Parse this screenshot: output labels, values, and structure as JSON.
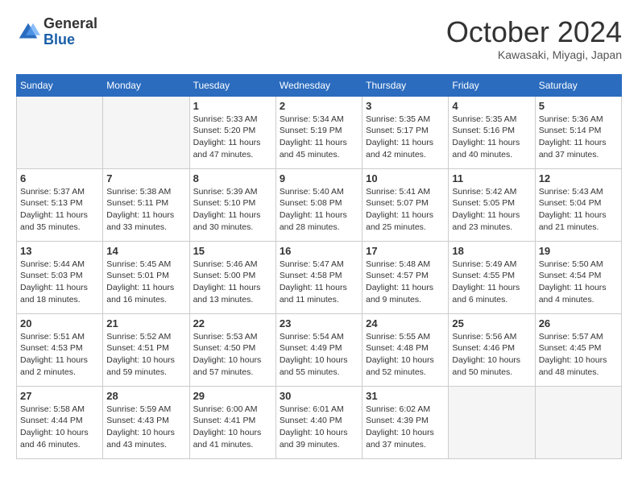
{
  "header": {
    "logo_line1": "General",
    "logo_line2": "Blue",
    "month_title": "October 2024",
    "location": "Kawasaki, Miyagi, Japan"
  },
  "days_of_week": [
    "Sunday",
    "Monday",
    "Tuesday",
    "Wednesday",
    "Thursday",
    "Friday",
    "Saturday"
  ],
  "weeks": [
    [
      {
        "num": "",
        "empty": true
      },
      {
        "num": "",
        "empty": true
      },
      {
        "num": "1",
        "sunrise": "5:33 AM",
        "sunset": "5:20 PM",
        "daylight": "11 hours and 47 minutes."
      },
      {
        "num": "2",
        "sunrise": "5:34 AM",
        "sunset": "5:19 PM",
        "daylight": "11 hours and 45 minutes."
      },
      {
        "num": "3",
        "sunrise": "5:35 AM",
        "sunset": "5:17 PM",
        "daylight": "11 hours and 42 minutes."
      },
      {
        "num": "4",
        "sunrise": "5:35 AM",
        "sunset": "5:16 PM",
        "daylight": "11 hours and 40 minutes."
      },
      {
        "num": "5",
        "sunrise": "5:36 AM",
        "sunset": "5:14 PM",
        "daylight": "11 hours and 37 minutes."
      }
    ],
    [
      {
        "num": "6",
        "sunrise": "5:37 AM",
        "sunset": "5:13 PM",
        "daylight": "11 hours and 35 minutes."
      },
      {
        "num": "7",
        "sunrise": "5:38 AM",
        "sunset": "5:11 PM",
        "daylight": "11 hours and 33 minutes."
      },
      {
        "num": "8",
        "sunrise": "5:39 AM",
        "sunset": "5:10 PM",
        "daylight": "11 hours and 30 minutes."
      },
      {
        "num": "9",
        "sunrise": "5:40 AM",
        "sunset": "5:08 PM",
        "daylight": "11 hours and 28 minutes."
      },
      {
        "num": "10",
        "sunrise": "5:41 AM",
        "sunset": "5:07 PM",
        "daylight": "11 hours and 25 minutes."
      },
      {
        "num": "11",
        "sunrise": "5:42 AM",
        "sunset": "5:05 PM",
        "daylight": "11 hours and 23 minutes."
      },
      {
        "num": "12",
        "sunrise": "5:43 AM",
        "sunset": "5:04 PM",
        "daylight": "11 hours and 21 minutes."
      }
    ],
    [
      {
        "num": "13",
        "sunrise": "5:44 AM",
        "sunset": "5:03 PM",
        "daylight": "11 hours and 18 minutes."
      },
      {
        "num": "14",
        "sunrise": "5:45 AM",
        "sunset": "5:01 PM",
        "daylight": "11 hours and 16 minutes."
      },
      {
        "num": "15",
        "sunrise": "5:46 AM",
        "sunset": "5:00 PM",
        "daylight": "11 hours and 13 minutes."
      },
      {
        "num": "16",
        "sunrise": "5:47 AM",
        "sunset": "4:58 PM",
        "daylight": "11 hours and 11 minutes."
      },
      {
        "num": "17",
        "sunrise": "5:48 AM",
        "sunset": "4:57 PM",
        "daylight": "11 hours and 9 minutes."
      },
      {
        "num": "18",
        "sunrise": "5:49 AM",
        "sunset": "4:55 PM",
        "daylight": "11 hours and 6 minutes."
      },
      {
        "num": "19",
        "sunrise": "5:50 AM",
        "sunset": "4:54 PM",
        "daylight": "11 hours and 4 minutes."
      }
    ],
    [
      {
        "num": "20",
        "sunrise": "5:51 AM",
        "sunset": "4:53 PM",
        "daylight": "11 hours and 2 minutes."
      },
      {
        "num": "21",
        "sunrise": "5:52 AM",
        "sunset": "4:51 PM",
        "daylight": "10 hours and 59 minutes."
      },
      {
        "num": "22",
        "sunrise": "5:53 AM",
        "sunset": "4:50 PM",
        "daylight": "10 hours and 57 minutes."
      },
      {
        "num": "23",
        "sunrise": "5:54 AM",
        "sunset": "4:49 PM",
        "daylight": "10 hours and 55 minutes."
      },
      {
        "num": "24",
        "sunrise": "5:55 AM",
        "sunset": "4:48 PM",
        "daylight": "10 hours and 52 minutes."
      },
      {
        "num": "25",
        "sunrise": "5:56 AM",
        "sunset": "4:46 PM",
        "daylight": "10 hours and 50 minutes."
      },
      {
        "num": "26",
        "sunrise": "5:57 AM",
        "sunset": "4:45 PM",
        "daylight": "10 hours and 48 minutes."
      }
    ],
    [
      {
        "num": "27",
        "sunrise": "5:58 AM",
        "sunset": "4:44 PM",
        "daylight": "10 hours and 46 minutes."
      },
      {
        "num": "28",
        "sunrise": "5:59 AM",
        "sunset": "4:43 PM",
        "daylight": "10 hours and 43 minutes."
      },
      {
        "num": "29",
        "sunrise": "6:00 AM",
        "sunset": "4:41 PM",
        "daylight": "10 hours and 41 minutes."
      },
      {
        "num": "30",
        "sunrise": "6:01 AM",
        "sunset": "4:40 PM",
        "daylight": "10 hours and 39 minutes."
      },
      {
        "num": "31",
        "sunrise": "6:02 AM",
        "sunset": "4:39 PM",
        "daylight": "10 hours and 37 minutes."
      },
      {
        "num": "",
        "empty": true
      },
      {
        "num": "",
        "empty": true
      }
    ]
  ],
  "labels": {
    "sunrise_prefix": "Sunrise: ",
    "sunset_prefix": "Sunset: ",
    "daylight_prefix": "Daylight: "
  }
}
